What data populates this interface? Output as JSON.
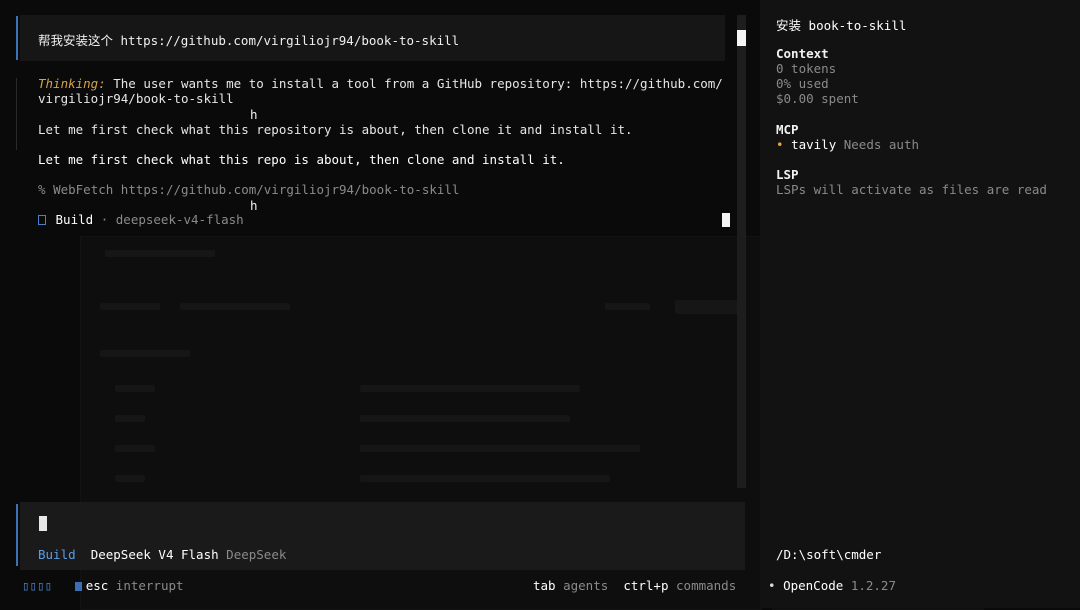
{
  "chat": {
    "user_message": "帮我安装这个 https://github.com/virgiliojr94/book-to-skill",
    "thinking_label": "Thinking:",
    "thinking_text_1": " The user wants me to install a tool from a GitHub repository: https://github.com/",
    "thinking_text_2": "virgiliojr94/book-to-skill",
    "stray_char": "h",
    "reasoning_line": "Let me first check what this repository is about, then clone it and install it.",
    "reply_line": "Let me first check what this repo is about, then clone and install it.",
    "tool_icon": "%",
    "tool_call": "WebFetch https://github.com/virgiliojr94/book-to-skill",
    "agent_icon": "agent-box-icon",
    "agent_name": "Build",
    "agent_sep": "·",
    "agent_model": "deepseek-v4-flash"
  },
  "input": {
    "agent_label": "Build",
    "model_name": "DeepSeek V4 Flash",
    "provider": "DeepSeek"
  },
  "footer": {
    "status_glyphs": "▯▯▯▯",
    "interrupt_key": "esc",
    "interrupt_label": "interrupt",
    "agents_key": "tab",
    "agents_label": "agents",
    "commands_key": "ctrl+p",
    "commands_label": "commands"
  },
  "sidebar": {
    "title_cn": "安装",
    "title_name": "book-to-skill",
    "context_heading": "Context",
    "tokens": "0 tokens",
    "used": "0% used",
    "spent": "$0.00 spent",
    "mcp_heading": "MCP",
    "mcp_server": "tavily",
    "mcp_status": "Needs auth",
    "lsp_heading": "LSP",
    "lsp_text": "LSPs will activate as files are read",
    "cwd": "/D:\\soft\\cmder",
    "app_name": "OpenCode",
    "app_version": "1.2.27"
  },
  "colors": {
    "accent_blue": "#3b73b9",
    "thinking_orange": "#d6a24a",
    "mcp_warning": "#e6a23c"
  }
}
